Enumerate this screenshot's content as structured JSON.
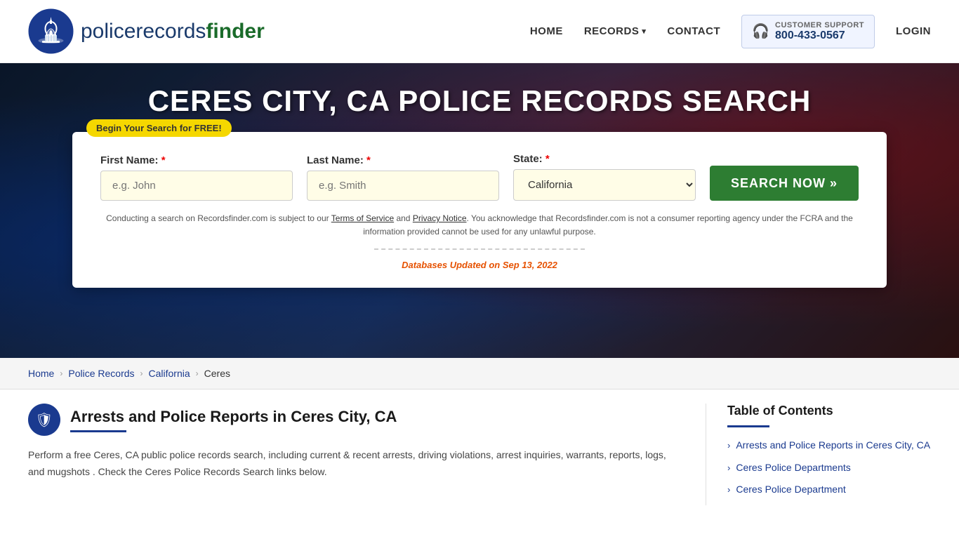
{
  "header": {
    "logo_text_regular": "policerecords",
    "logo_text_bold": "finder",
    "nav": {
      "home_label": "HOME",
      "records_label": "RECORDS",
      "contact_label": "CONTACT",
      "support_label": "CUSTOMER SUPPORT",
      "support_number": "800-433-0567",
      "login_label": "LOGIN"
    }
  },
  "hero": {
    "title": "CERES CITY, CA POLICE RECORDS SEARCH"
  },
  "search": {
    "badge_label": "Begin Your Search for FREE!",
    "first_name_label": "First Name:",
    "last_name_label": "Last Name:",
    "state_label": "State:",
    "first_name_placeholder": "e.g. John",
    "last_name_placeholder": "e.g. Smith",
    "state_value": "California",
    "search_btn_label": "SEARCH NOW »",
    "disclaimer_text": "Conducting a search on Recordsfinder.com is subject to our Terms of Service and Privacy Notice. You acknowledge that Recordsfinder.com is not a consumer reporting agency under the FCRA and the information provided cannot be used for any unlawful purpose.",
    "db_updated_label": "Databases Updated on",
    "db_updated_date": "Sep 13, 2022"
  },
  "breadcrumb": {
    "home": "Home",
    "police_records": "Police Records",
    "california": "California",
    "current": "Ceres"
  },
  "article": {
    "title": "Arrests and Police Reports in Ceres City, CA",
    "body": "Perform a free Ceres, CA public police records search, including current & recent arrests, driving violations, arrest inquiries, warrants, reports, logs, and mugshots . Check the Ceres Police Records Search links below."
  },
  "toc": {
    "title": "Table of Contents",
    "items": [
      {
        "label": "Arrests and Police Reports in Ceres City, CA"
      },
      {
        "label": "Ceres Police Departments"
      },
      {
        "label": "Ceres Police Department"
      }
    ]
  }
}
